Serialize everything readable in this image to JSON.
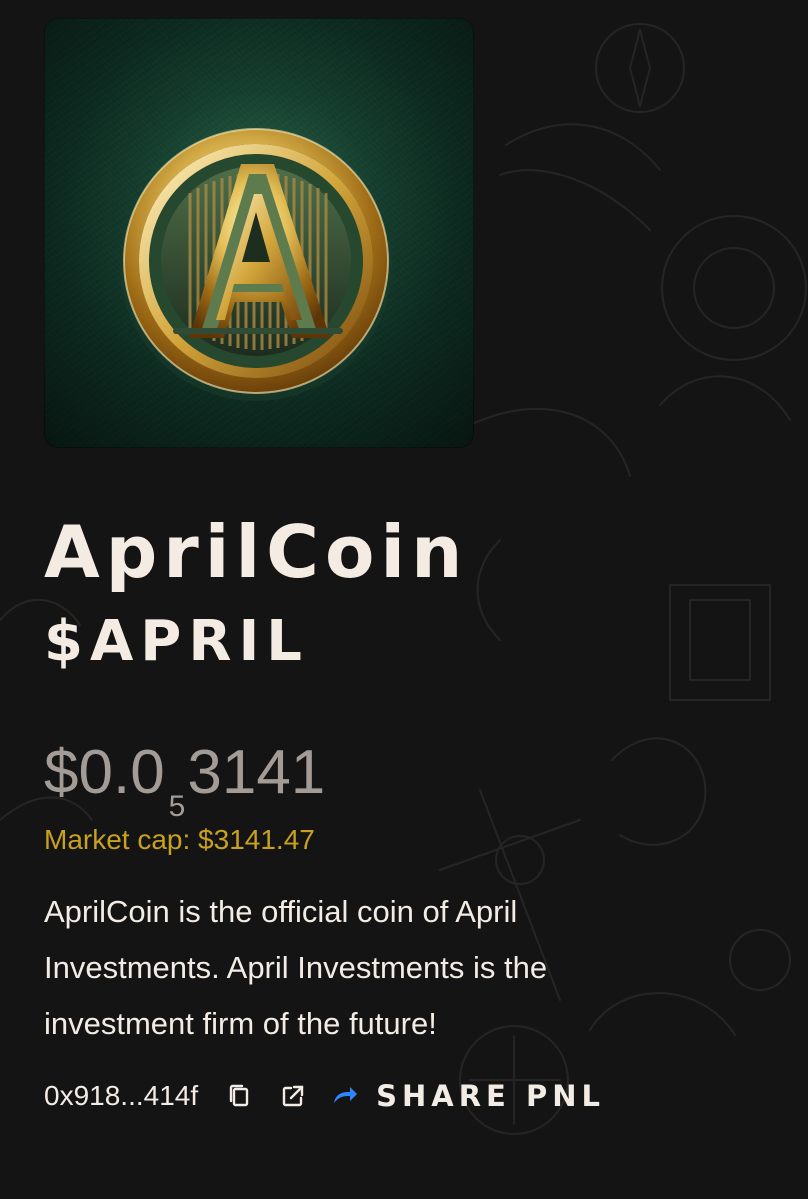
{
  "token": {
    "name": "AprilCoin",
    "ticker": "$APRIL",
    "price": {
      "prefix": "$0.0",
      "subscript": "5",
      "suffix": "3141"
    },
    "market_cap": "Market cap: $3141.47",
    "description": "AprilCoin is the official coin of April Investments. April Investments is the investment firm of the future!",
    "address": "0x918...414f"
  },
  "actions": {
    "copy_icon": "copy-icon",
    "external_link_icon": "external-link-icon",
    "share_icon": "share-arrow-icon",
    "share_label": "SHARE PNL"
  },
  "colors": {
    "background": "#141414",
    "text": "#f3ece4",
    "muted": "#a39b95",
    "accent_gold": "#c8a120",
    "share_blue": "#2d86ff"
  }
}
